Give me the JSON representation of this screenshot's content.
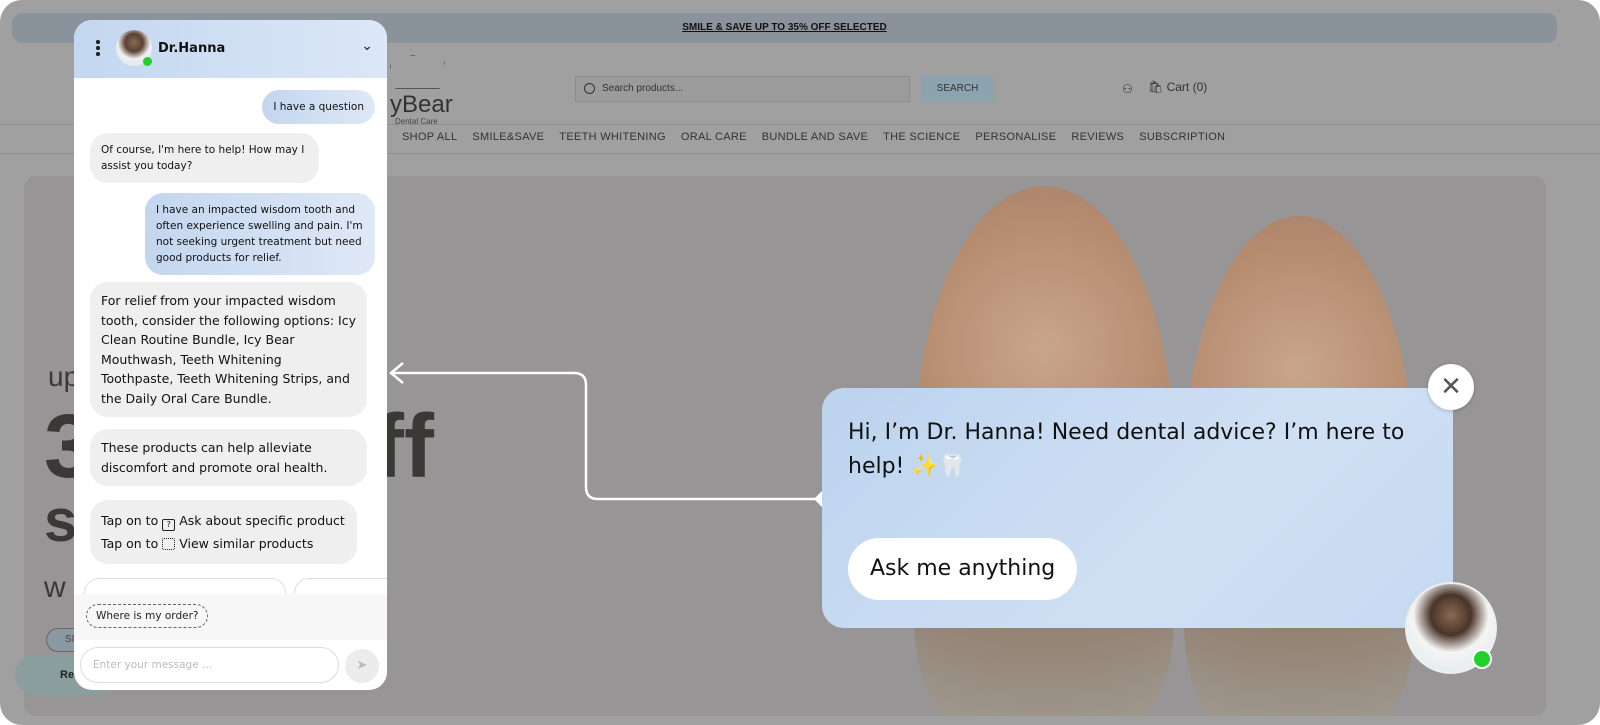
{
  "promo_banner": "SMILE & SAVE UP TO 35% OFF SELECTED",
  "logo": {
    "word": "yBear",
    "sub": "Dental Care"
  },
  "search": {
    "placeholder": "Search products...",
    "button": "SEARCH"
  },
  "cart_label": "Cart (0)",
  "nav": [
    "SHOP ALL",
    "SMILE&SAVE",
    "TEETH WHITENING",
    "ORAL CARE",
    "BUNDLE AND SAVE",
    "THE SCIENCE",
    "PERSONALISE",
    "REVIEWS",
    "SUBSCRIPTION"
  ],
  "hero_fragments": [
    "up",
    "3",
    "ff",
    "s",
    "w",
    "SI"
  ],
  "rewards_label": "Re",
  "chat": {
    "agent_name": "Dr.Hanna",
    "messages": [
      {
        "from": "user",
        "text": "I have a question"
      },
      {
        "from": "bot",
        "text": "Of course, I'm here to help! How may I assist you today?"
      },
      {
        "from": "user",
        "text": "I have an impacted wisdom tooth and often experience swelling and pain. I'm not seeking urgent treatment but need good products for relief."
      },
      {
        "from": "bot",
        "text": "For relief from your impacted wisdom tooth, consider the following options: Icy Clean Routine Bundle, Icy Bear Mouthwash, Teeth Whitening Toothpaste, Teeth Whitening Strips, and the Daily Oral Care Bundle."
      },
      {
        "from": "bot",
        "text": "These products can help alleviate discomfort and promote oral health."
      }
    ],
    "tips": {
      "prefix": "Tap on to",
      "ask": "Ask about specific product",
      "similar": "View similar products"
    },
    "quick_reply": "Where is my order?",
    "input_placeholder": "Enter your message ..."
  },
  "popup": {
    "text": "Hi, I’m Dr. Hanna! Need dental advice? I’m here to help! ✨🦷",
    "button": "Ask me anything"
  },
  "colors": {
    "online": "#1fd12a",
    "bubble_user": "#c3d6ef",
    "bubble_bot": "#efefef"
  }
}
